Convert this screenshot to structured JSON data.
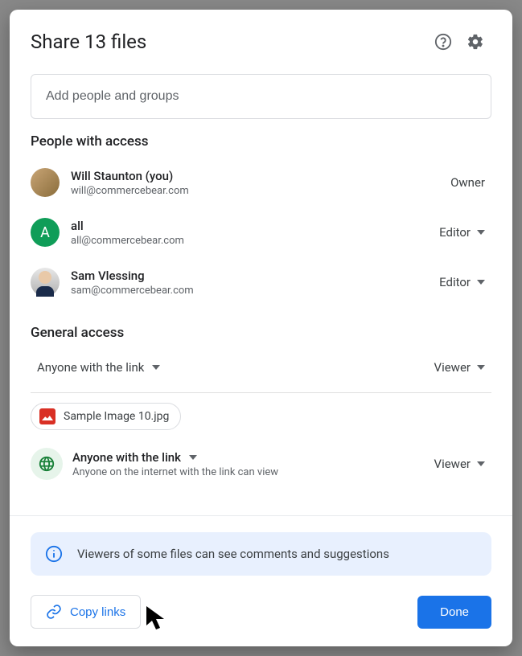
{
  "header": {
    "title": "Share 13 files"
  },
  "input": {
    "placeholder": "Add people and groups"
  },
  "people_section": {
    "title": "People with access",
    "people": [
      {
        "name": "Will Staunton (you)",
        "email": "will@commercebear.com",
        "role": "Owner",
        "avatar_letter": ""
      },
      {
        "name": "all",
        "email": "all@commercebear.com",
        "role": "Editor",
        "avatar_letter": "A"
      },
      {
        "name": "Sam Vlessing",
        "email": "sam@commercebear.com",
        "role": "Editor",
        "avatar_letter": ""
      }
    ]
  },
  "general_section": {
    "title": "General access",
    "access_label": "Anyone with the link",
    "role": "Viewer"
  },
  "file_chip": {
    "name": "Sample Image 10.jpg"
  },
  "link_access": {
    "title": "Anyone with the link",
    "description": "Anyone on the internet with the link can view",
    "role": "Viewer"
  },
  "banner": {
    "text": "Viewers of some files can see comments and suggestions"
  },
  "footer": {
    "copy_label": "Copy links",
    "done_label": "Done"
  }
}
